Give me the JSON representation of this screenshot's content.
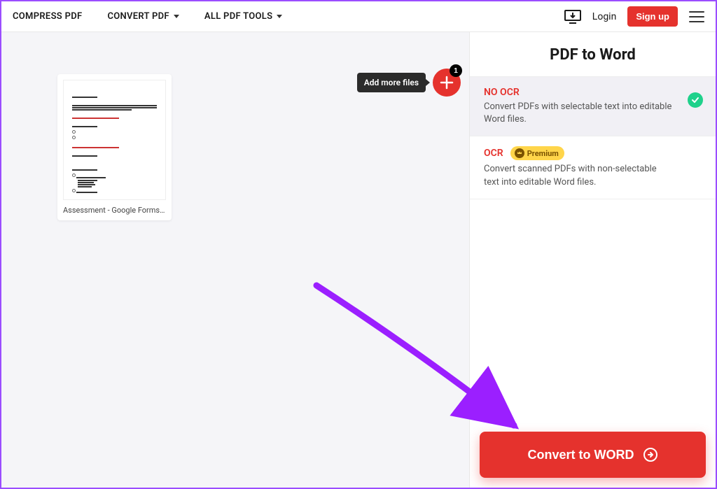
{
  "nav": {
    "compress": "COMPRESS PDF",
    "convert": "CONVERT PDF",
    "all_tools": "ALL PDF TOOLS",
    "login": "Login",
    "signup": "Sign up"
  },
  "work": {
    "add_more_tooltip": "Add more files",
    "badge_count": "1",
    "file_name": "Assessment - Google Forms.pdf"
  },
  "sidebar": {
    "title": "PDF to Word",
    "options": {
      "no_ocr": {
        "title": "NO OCR",
        "desc": "Convert PDFs with selectable text into editable Word files."
      },
      "ocr": {
        "title": "OCR",
        "premium_label": "Premium",
        "desc": "Convert scanned PDFs with non-selectable text into editable Word files."
      }
    },
    "convert_label": "Convert to WORD"
  }
}
